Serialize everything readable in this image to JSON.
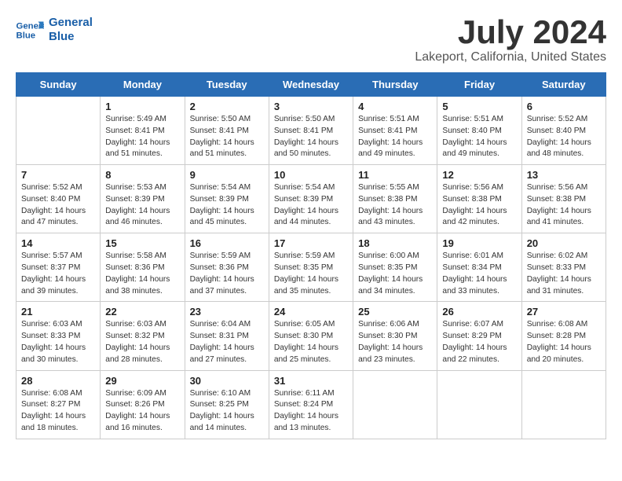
{
  "logo": {
    "line1": "General",
    "line2": "Blue"
  },
  "title": "July 2024",
  "subtitle": "Lakeport, California, United States",
  "weekdays": [
    "Sunday",
    "Monday",
    "Tuesday",
    "Wednesday",
    "Thursday",
    "Friday",
    "Saturday"
  ],
  "weeks": [
    [
      {
        "day": "",
        "sunrise": "",
        "sunset": "",
        "daylight": ""
      },
      {
        "day": "1",
        "sunrise": "Sunrise: 5:49 AM",
        "sunset": "Sunset: 8:41 PM",
        "daylight": "Daylight: 14 hours and 51 minutes."
      },
      {
        "day": "2",
        "sunrise": "Sunrise: 5:50 AM",
        "sunset": "Sunset: 8:41 PM",
        "daylight": "Daylight: 14 hours and 51 minutes."
      },
      {
        "day": "3",
        "sunrise": "Sunrise: 5:50 AM",
        "sunset": "Sunset: 8:41 PM",
        "daylight": "Daylight: 14 hours and 50 minutes."
      },
      {
        "day": "4",
        "sunrise": "Sunrise: 5:51 AM",
        "sunset": "Sunset: 8:41 PM",
        "daylight": "Daylight: 14 hours and 49 minutes."
      },
      {
        "day": "5",
        "sunrise": "Sunrise: 5:51 AM",
        "sunset": "Sunset: 8:40 PM",
        "daylight": "Daylight: 14 hours and 49 minutes."
      },
      {
        "day": "6",
        "sunrise": "Sunrise: 5:52 AM",
        "sunset": "Sunset: 8:40 PM",
        "daylight": "Daylight: 14 hours and 48 minutes."
      }
    ],
    [
      {
        "day": "7",
        "sunrise": "Sunrise: 5:52 AM",
        "sunset": "Sunset: 8:40 PM",
        "daylight": "Daylight: 14 hours and 47 minutes."
      },
      {
        "day": "8",
        "sunrise": "Sunrise: 5:53 AM",
        "sunset": "Sunset: 8:39 PM",
        "daylight": "Daylight: 14 hours and 46 minutes."
      },
      {
        "day": "9",
        "sunrise": "Sunrise: 5:54 AM",
        "sunset": "Sunset: 8:39 PM",
        "daylight": "Daylight: 14 hours and 45 minutes."
      },
      {
        "day": "10",
        "sunrise": "Sunrise: 5:54 AM",
        "sunset": "Sunset: 8:39 PM",
        "daylight": "Daylight: 14 hours and 44 minutes."
      },
      {
        "day": "11",
        "sunrise": "Sunrise: 5:55 AM",
        "sunset": "Sunset: 8:38 PM",
        "daylight": "Daylight: 14 hours and 43 minutes."
      },
      {
        "day": "12",
        "sunrise": "Sunrise: 5:56 AM",
        "sunset": "Sunset: 8:38 PM",
        "daylight": "Daylight: 14 hours and 42 minutes."
      },
      {
        "day": "13",
        "sunrise": "Sunrise: 5:56 AM",
        "sunset": "Sunset: 8:38 PM",
        "daylight": "Daylight: 14 hours and 41 minutes."
      }
    ],
    [
      {
        "day": "14",
        "sunrise": "Sunrise: 5:57 AM",
        "sunset": "Sunset: 8:37 PM",
        "daylight": "Daylight: 14 hours and 39 minutes."
      },
      {
        "day": "15",
        "sunrise": "Sunrise: 5:58 AM",
        "sunset": "Sunset: 8:36 PM",
        "daylight": "Daylight: 14 hours and 38 minutes."
      },
      {
        "day": "16",
        "sunrise": "Sunrise: 5:59 AM",
        "sunset": "Sunset: 8:36 PM",
        "daylight": "Daylight: 14 hours and 37 minutes."
      },
      {
        "day": "17",
        "sunrise": "Sunrise: 5:59 AM",
        "sunset": "Sunset: 8:35 PM",
        "daylight": "Daylight: 14 hours and 35 minutes."
      },
      {
        "day": "18",
        "sunrise": "Sunrise: 6:00 AM",
        "sunset": "Sunset: 8:35 PM",
        "daylight": "Daylight: 14 hours and 34 minutes."
      },
      {
        "day": "19",
        "sunrise": "Sunrise: 6:01 AM",
        "sunset": "Sunset: 8:34 PM",
        "daylight": "Daylight: 14 hours and 33 minutes."
      },
      {
        "day": "20",
        "sunrise": "Sunrise: 6:02 AM",
        "sunset": "Sunset: 8:33 PM",
        "daylight": "Daylight: 14 hours and 31 minutes."
      }
    ],
    [
      {
        "day": "21",
        "sunrise": "Sunrise: 6:03 AM",
        "sunset": "Sunset: 8:33 PM",
        "daylight": "Daylight: 14 hours and 30 minutes."
      },
      {
        "day": "22",
        "sunrise": "Sunrise: 6:03 AM",
        "sunset": "Sunset: 8:32 PM",
        "daylight": "Daylight: 14 hours and 28 minutes."
      },
      {
        "day": "23",
        "sunrise": "Sunrise: 6:04 AM",
        "sunset": "Sunset: 8:31 PM",
        "daylight": "Daylight: 14 hours and 27 minutes."
      },
      {
        "day": "24",
        "sunrise": "Sunrise: 6:05 AM",
        "sunset": "Sunset: 8:30 PM",
        "daylight": "Daylight: 14 hours and 25 minutes."
      },
      {
        "day": "25",
        "sunrise": "Sunrise: 6:06 AM",
        "sunset": "Sunset: 8:30 PM",
        "daylight": "Daylight: 14 hours and 23 minutes."
      },
      {
        "day": "26",
        "sunrise": "Sunrise: 6:07 AM",
        "sunset": "Sunset: 8:29 PM",
        "daylight": "Daylight: 14 hours and 22 minutes."
      },
      {
        "day": "27",
        "sunrise": "Sunrise: 6:08 AM",
        "sunset": "Sunset: 8:28 PM",
        "daylight": "Daylight: 14 hours and 20 minutes."
      }
    ],
    [
      {
        "day": "28",
        "sunrise": "Sunrise: 6:08 AM",
        "sunset": "Sunset: 8:27 PM",
        "daylight": "Daylight: 14 hours and 18 minutes."
      },
      {
        "day": "29",
        "sunrise": "Sunrise: 6:09 AM",
        "sunset": "Sunset: 8:26 PM",
        "daylight": "Daylight: 14 hours and 16 minutes."
      },
      {
        "day": "30",
        "sunrise": "Sunrise: 6:10 AM",
        "sunset": "Sunset: 8:25 PM",
        "daylight": "Daylight: 14 hours and 14 minutes."
      },
      {
        "day": "31",
        "sunrise": "Sunrise: 6:11 AM",
        "sunset": "Sunset: 8:24 PM",
        "daylight": "Daylight: 14 hours and 13 minutes."
      },
      {
        "day": "",
        "sunrise": "",
        "sunset": "",
        "daylight": ""
      },
      {
        "day": "",
        "sunrise": "",
        "sunset": "",
        "daylight": ""
      },
      {
        "day": "",
        "sunrise": "",
        "sunset": "",
        "daylight": ""
      }
    ]
  ]
}
